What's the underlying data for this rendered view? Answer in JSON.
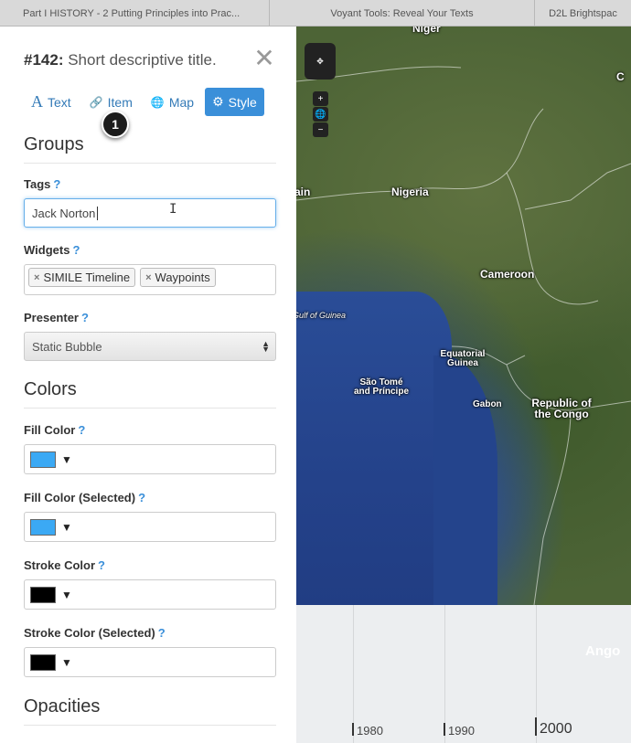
{
  "browser_tabs": [
    {
      "title": "Part I HISTORY - 2 Putting Principles into Prac..."
    },
    {
      "title": "Voyant Tools: Reveal Your Texts"
    },
    {
      "title": "D2L Brightspac"
    }
  ],
  "panel": {
    "id": "#142:",
    "title": "Short descriptive title.",
    "close_glyph": "✕",
    "tabs": [
      {
        "label": "Text",
        "icon": "text-icon",
        "glyph": "A"
      },
      {
        "label": "Item",
        "icon": "link-icon",
        "glyph": "🔗"
      },
      {
        "label": "Map",
        "icon": "globe-icon",
        "glyph": "🌐"
      },
      {
        "label": "Style",
        "icon": "gear-icon",
        "glyph": "⚙",
        "active": true
      }
    ],
    "step_marker": "1",
    "groups_heading": "Groups",
    "tags_label": "Tags",
    "tags_value": "Jack Norton",
    "widgets_label": "Widgets",
    "widgets": [
      "SIMILE Timeline",
      "Waypoints"
    ],
    "remove_glyph": "×",
    "presenter_label": "Presenter",
    "presenter_value": "Static Bubble",
    "colors_heading": "Colors",
    "fill_color_label": "Fill Color",
    "fill_color_selected_label": "Fill Color (Selected)",
    "stroke_color_label": "Stroke Color",
    "stroke_color_selected_label": "Stroke Color (Selected)",
    "opacities_heading": "Opacities",
    "help_glyph": "?",
    "dropdown_glyph": "▼",
    "colors": {
      "fill": "#3ba9f4",
      "fill_selected": "#3ba9f4",
      "stroke": "#000000",
      "stroke_selected": "#000000"
    }
  },
  "map": {
    "labels": [
      "Nigeria",
      "Cameroon",
      "Gulf of Guinea",
      "Equatorial Guinea",
      "São Tomé and Príncipe",
      "Gabon",
      "Republic of the Congo",
      "Niger",
      "ain",
      "C"
    ],
    "zoom_in": "+",
    "zoom_out": "−"
  },
  "timeline": {
    "years": [
      "1980",
      "1990",
      "2000"
    ],
    "faint_label": "Ango"
  },
  "accent_color": "#3a8fd9"
}
